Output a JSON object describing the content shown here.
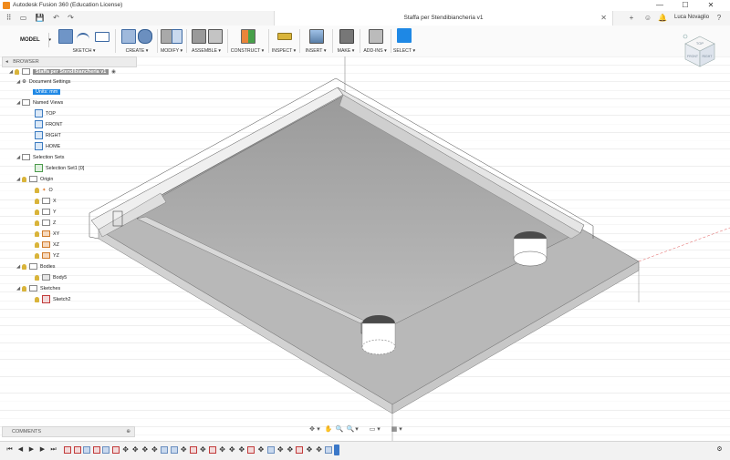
{
  "window": {
    "title": "Autodesk Fusion 360 (Education License)",
    "user": "Luca Novaglio",
    "minimize": "—",
    "maximize": "☐",
    "close": "✕"
  },
  "document_tab": {
    "title": "Staffa per Stendibiancheria v1",
    "close": "✕"
  },
  "quick_access": [
    "⠿",
    "▭",
    "💾",
    "↶",
    "↷"
  ],
  "tabbar_right": [
    "+",
    "☺",
    "🕒",
    "🔔",
    "?"
  ],
  "workspace": {
    "label": "MODEL"
  },
  "toolbar": {
    "groups": [
      {
        "label": "SKETCH ▾",
        "icons": [
          "sketch-create-icon",
          "arc-icon",
          "rectangle-icon"
        ]
      },
      {
        "label": "CREATE ▾",
        "icons": [
          "extrude-icon",
          "revolve-icon"
        ]
      },
      {
        "label": "MODIFY ▾",
        "icons": [
          "press-pull-icon",
          "fillet-icon"
        ]
      },
      {
        "label": "ASSEMBLE ▾",
        "icons": [
          "new-component-icon",
          "joint-icon"
        ]
      },
      {
        "label": "CONSTRUCT ▾",
        "icons": [
          "plane-icon"
        ]
      },
      {
        "label": "INSPECT ▾",
        "icons": [
          "measure-icon"
        ]
      },
      {
        "label": "INSERT ▾",
        "icons": [
          "insert-image-icon"
        ]
      },
      {
        "label": "MAKE ▾",
        "icons": [
          "print-3d-icon"
        ]
      },
      {
        "label": "ADD-INS ▾",
        "icons": [
          "scripts-icon"
        ]
      },
      {
        "label": "SELECT ▾",
        "icons": [
          "select-arrow-icon"
        ]
      }
    ]
  },
  "colors": {
    "accent": "#1e88e5",
    "bulb": "#d9b43a",
    "grid": "#cfcfcf",
    "floor": "#b3b3b3",
    "wall": "#e6e6e6",
    "select_active": "#1e88e5"
  },
  "browser": {
    "header": "BROWSER",
    "root": "Staffa per Stendibiancheria v1",
    "items": [
      {
        "label": "Document Settings",
        "type": "settings"
      },
      {
        "label": "Units: mm",
        "type": "units"
      },
      {
        "label": "Named Views",
        "type": "folder"
      },
      {
        "label": "TOP",
        "type": "view"
      },
      {
        "label": "FRONT",
        "type": "view"
      },
      {
        "label": "RIGHT",
        "type": "view"
      },
      {
        "label": "HOME",
        "type": "view"
      },
      {
        "label": "Selection Sets",
        "type": "folder"
      },
      {
        "label": "Selection Set1 [0]",
        "type": "selection"
      },
      {
        "label": "Origin",
        "type": "folder"
      },
      {
        "label": "O",
        "type": "origin-point"
      },
      {
        "label": "X",
        "type": "axis"
      },
      {
        "label": "Y",
        "type": "axis"
      },
      {
        "label": "Z",
        "type": "axis"
      },
      {
        "label": "XY",
        "type": "plane"
      },
      {
        "label": "XZ",
        "type": "plane"
      },
      {
        "label": "YZ",
        "type": "plane"
      },
      {
        "label": "Bodies",
        "type": "folder"
      },
      {
        "label": "Body5",
        "type": "body"
      },
      {
        "label": "Sketches",
        "type": "folder"
      },
      {
        "label": "Sketch2",
        "type": "sketch"
      }
    ]
  },
  "comments": {
    "label": "COMMENTS",
    "action": "⊕"
  },
  "viewcube": {
    "top": "TOP",
    "front": "FRONT",
    "right": "RIGHT"
  },
  "navbar": [
    "✥",
    "▾",
    "✋",
    "🔍",
    "🔍",
    "▾",
    "▭",
    "▾",
    "▦",
    "▾"
  ],
  "timeline": {
    "playback": [
      "⏮",
      "◀",
      "▶",
      "▶",
      "⏭"
    ],
    "settings": "⚙"
  }
}
